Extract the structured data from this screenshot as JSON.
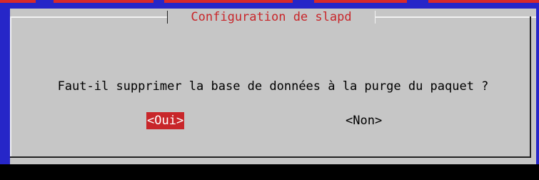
{
  "dialog": {
    "title": "Configuration de slapd",
    "question": "Faut-il supprimer la base de données à la purge du paquet ?",
    "buttons": {
      "yes_label": "<Oui>",
      "no_label": "<Non>"
    },
    "selected_button": "yes"
  },
  "colors": {
    "background_blue": "#2626c8",
    "dialog_gray": "#c6c6c6",
    "accent_red": "#c8262a",
    "shadow": "#000000"
  }
}
